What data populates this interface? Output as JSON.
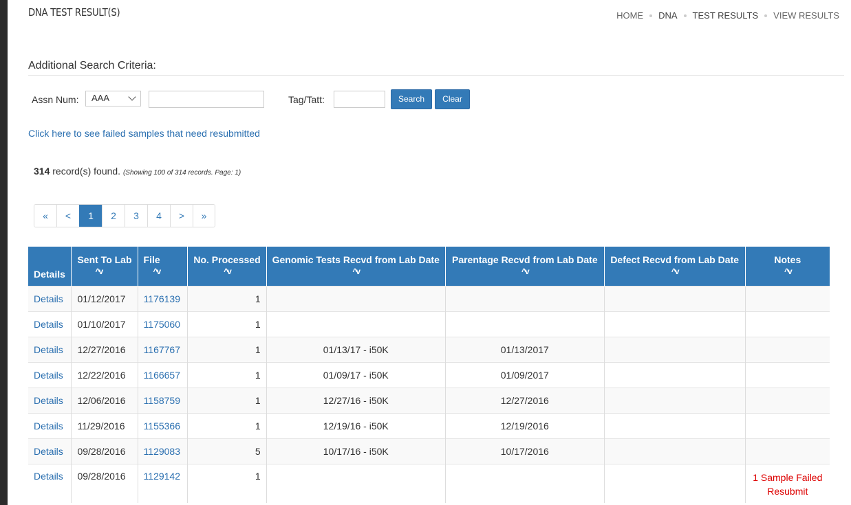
{
  "page": {
    "title": "DNA TEST RESULT(S)"
  },
  "breadcrumb": [
    "HOME",
    "DNA",
    "TEST RESULTS",
    "VIEW RESULTS"
  ],
  "search": {
    "heading": "Additional Search Criteria:",
    "assn_label": "Assn Num:",
    "assn_select_value": "AAA",
    "assn_text_value": "",
    "tag_label": "Tag/Tatt:",
    "tag_value": "",
    "search_button": "Search",
    "clear_button": "Clear"
  },
  "failed_link": "Click here to see failed samples that need resubmitted",
  "records": {
    "count": "314",
    "label": "record(s) found.",
    "detail": "(Showing 100 of 314 records. Page: 1)"
  },
  "pager": [
    "«",
    "<",
    "1",
    "2",
    "3",
    "4",
    ">",
    "»"
  ],
  "table": {
    "headers": [
      "Details",
      "Sent To Lab",
      "File",
      "No. Processed",
      "Genomic Tests Recvd from Lab Date",
      "Parentage Recvd from Lab Date",
      "Defect Recvd from Lab Date",
      "Notes"
    ],
    "sort_glyph": "^v",
    "rows": [
      {
        "details": "Details",
        "sent": "01/12/2017",
        "file": "1176139",
        "processed": "1",
        "genomic": "",
        "parentage": "",
        "defect": "",
        "notes": ""
      },
      {
        "details": "Details",
        "sent": "01/10/2017",
        "file": "1175060",
        "processed": "1",
        "genomic": "",
        "parentage": "",
        "defect": "",
        "notes": ""
      },
      {
        "details": "Details",
        "sent": "12/27/2016",
        "file": "1167767",
        "processed": "1",
        "genomic": "01/13/17 - i50K",
        "parentage": "01/13/2017",
        "defect": "",
        "notes": ""
      },
      {
        "details": "Details",
        "sent": "12/22/2016",
        "file": "1166657",
        "processed": "1",
        "genomic": "01/09/17 - i50K",
        "parentage": "01/09/2017",
        "defect": "",
        "notes": ""
      },
      {
        "details": "Details",
        "sent": "12/06/2016",
        "file": "1158759",
        "processed": "1",
        "genomic": "12/27/16 - i50K",
        "parentage": "12/27/2016",
        "defect": "",
        "notes": ""
      },
      {
        "details": "Details",
        "sent": "11/29/2016",
        "file": "1155366",
        "processed": "1",
        "genomic": "12/19/16 - i50K",
        "parentage": "12/19/2016",
        "defect": "",
        "notes": ""
      },
      {
        "details": "Details",
        "sent": "09/28/2016",
        "file": "1129083",
        "processed": "5",
        "genomic": "10/17/16 - i50K",
        "parentage": "10/17/2016",
        "defect": "",
        "notes": ""
      },
      {
        "details": "Details",
        "sent": "09/28/2016",
        "file": "1129142",
        "processed": "1",
        "genomic": "",
        "parentage": "",
        "defect": "",
        "notes": "1 Sample Failed Resubmit"
      }
    ]
  },
  "colors": {
    "primary": "#337ab7",
    "link": "#2a6fb0",
    "alert": "#dd0000"
  }
}
